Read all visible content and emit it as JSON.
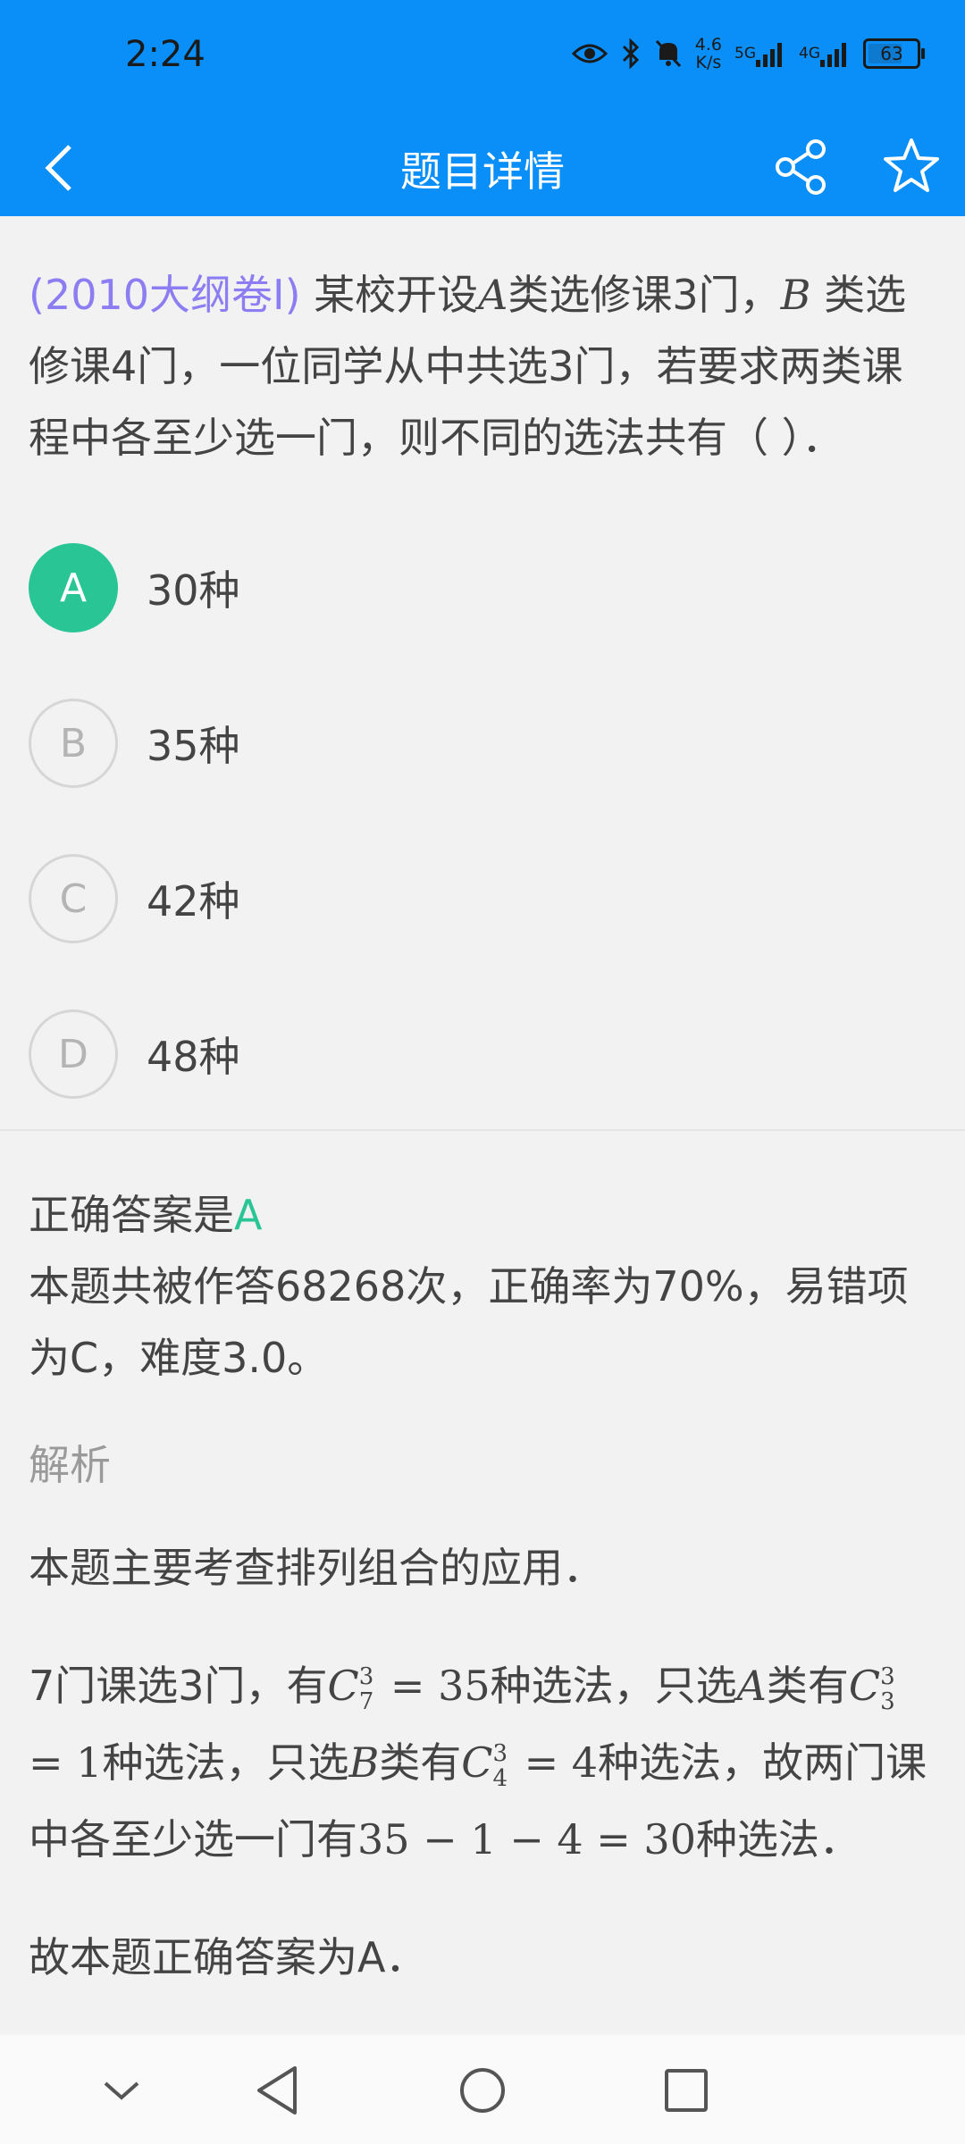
{
  "status_bar": {
    "time": "2:24",
    "speed_value": "4.6",
    "speed_unit": "K/s",
    "network_1": "5G",
    "network_2": "4G",
    "battery": "63"
  },
  "header": {
    "title": "题目详情",
    "background_color": "#0a8ef7"
  },
  "question": {
    "source": "(2010大纲卷I)",
    "text_part1": " 某校开设",
    "var_a": "A",
    "text_part2": "类选修课3门，",
    "var_b": "B",
    "text_part3": " 类选修课4门，一位同学从中共选3门，若要求两类课程中各至少选一门，则不同的选法共有（  ）．"
  },
  "options": [
    {
      "letter": "A",
      "text": "30种",
      "selected": true
    },
    {
      "letter": "B",
      "text": "35种",
      "selected": false
    },
    {
      "letter": "C",
      "text": "42种",
      "selected": false
    },
    {
      "letter": "D",
      "text": "48种",
      "selected": false
    }
  ],
  "answer": {
    "correct_prefix": "正确答案是",
    "correct_letter": "A",
    "stats": "本题共被作答68268次，正确率为70%，易错项为C，难度3.0。",
    "accent_color": "#29c594"
  },
  "analysis": {
    "title": "解析",
    "p1": "本题主要考查排列组合的应用．",
    "p2_a": "7门课选3门，有",
    "c73": "C",
    "c73_sup": "3",
    "c73_sub": "7",
    "c73_eq": " = 35",
    "p2_b": "种选法，只选",
    "var_a": "A",
    "p2_c": "类有",
    "c33": "C",
    "c33_sup": "3",
    "c33_sub": "3",
    "c33_eq": " = 1",
    "p2_d": "种选法，只选",
    "var_b": "B",
    "p2_e": "类有",
    "c43": "C",
    "c43_sup": "3",
    "c43_sub": "4",
    "c43_eq": " = 4",
    "p2_f": "种选法，故两门课中各至少选一门有",
    "calc": "35 − 1 − 4 = 30",
    "p2_g": "种选法．",
    "p3": "故本题正确答案为A．"
  },
  "icons": {
    "back": "chevron-left-icon",
    "share": "share-icon",
    "star": "star-outline-icon"
  }
}
